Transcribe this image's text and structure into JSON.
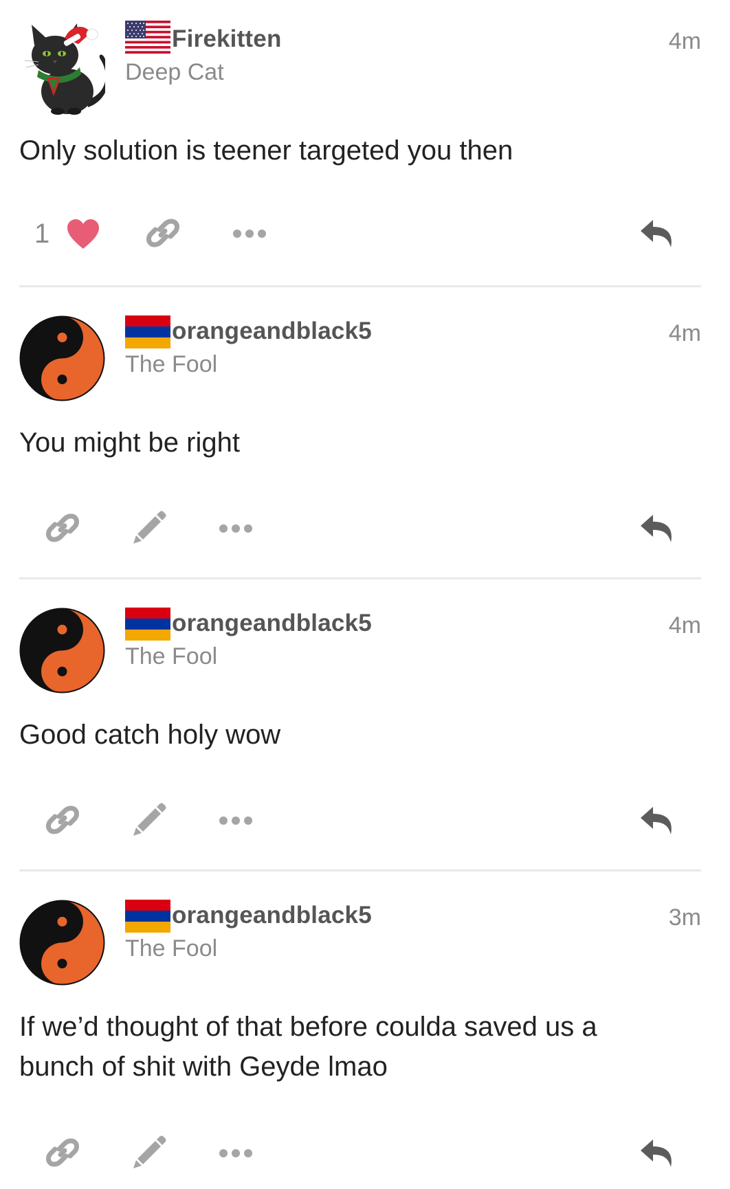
{
  "colors": {
    "username": "#555555",
    "meta": "#8a8a8a",
    "icon_gray": "#a5a5a5",
    "icon_dark": "#5c5c5c",
    "heart": "#e85d75",
    "divider": "#e9e9e9",
    "orange": "#e8652c"
  },
  "posts": [
    {
      "username": "Firekitten",
      "user_title": "Deep Cat",
      "time": "4m",
      "flag": "usa-flag",
      "avatar": "black-cat-santa-avatar",
      "body": "Only solution is teener targeted you then",
      "like_count": "1",
      "actions": [
        "heart-icon",
        "link-icon",
        "more-icon",
        "reply-icon"
      ]
    },
    {
      "username": "orangeandblack5",
      "user_title": "The Fool",
      "time": "4m",
      "flag": "armenia-flag",
      "avatar": "yin-yang-avatar",
      "body": "You might be right",
      "actions": [
        "link-icon",
        "edit-icon",
        "more-icon",
        "reply-icon"
      ]
    },
    {
      "username": "orangeandblack5",
      "user_title": "The Fool",
      "time": "4m",
      "flag": "armenia-flag",
      "avatar": "yin-yang-avatar",
      "body": "Good catch holy wow",
      "actions": [
        "link-icon",
        "edit-icon",
        "more-icon",
        "reply-icon"
      ]
    },
    {
      "username": "orangeandblack5",
      "user_title": "The Fool",
      "time": "3m",
      "flag": "armenia-flag",
      "avatar": "yin-yang-avatar",
      "body_lines": [
        "If we’d thought of that before coulda saved us a",
        "bunch of shit with Geyde lmao"
      ],
      "actions": [
        "link-icon",
        "edit-icon",
        "more-icon",
        "reply-icon"
      ]
    }
  ]
}
